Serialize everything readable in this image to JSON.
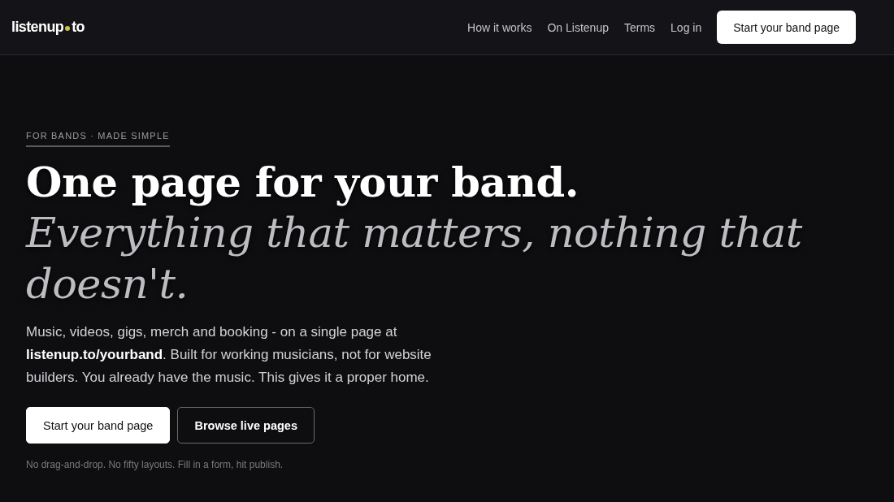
{
  "header": {
    "logo": {
      "name": "listenup",
      "suffix": "to"
    },
    "nav_links": [
      "How it works",
      "On Listenup",
      "Terms",
      "Log in"
    ],
    "cta": "Start your band page"
  },
  "hero": {
    "eyebrow": "FOR BANDS · MADE SIMPLE",
    "headline": "One page for your band.",
    "subheadline": "Everything that matters, nothing that doesn't.",
    "description": "Music, videos, gigs, merch and booking - on a single page at **listenup.to/yourband**. Built for working musicians, not for website builders. You already have the music. This gives it a proper home.",
    "buttons": [
      {
        "label": "Start your band page",
        "kind": "primary"
      },
      {
        "label": "Browse live pages",
        "kind": "secondary"
      }
    ],
    "note": "No drag-and-drop. No fifty layouts. Fill in a form, hit publish."
  }
}
